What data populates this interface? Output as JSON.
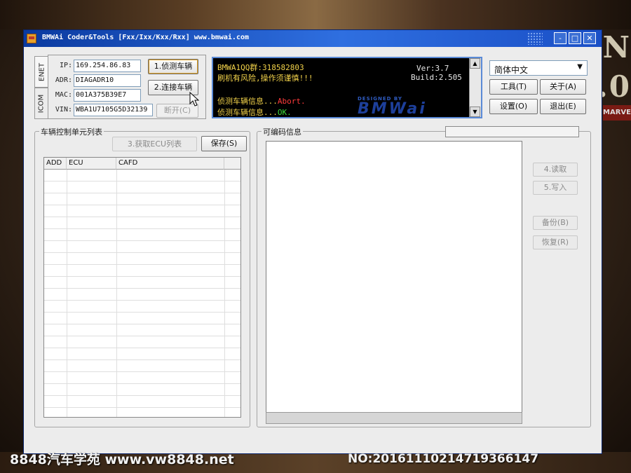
{
  "window": {
    "title": "BMWAi Coder&Tools [Fxx/Ixx/Kxx/Rxx]  www.bmwai.com",
    "controls": {
      "minimize": "-",
      "maximize": "□",
      "close": "✕"
    }
  },
  "side_tabs": [
    "ENET",
    "ICOM"
  ],
  "connection": {
    "ip_label": "IP:",
    "ip_value": "169.254.86.83",
    "adr_label": "ADR:",
    "adr_value": "DIAGADR10",
    "mac_label": "MAC:",
    "mac_value": "001A375B39E7",
    "vin_label": "VIN:",
    "vin_value": "WBA1U7105G5D32139",
    "detect_button": "1.侦测车辆",
    "connect_button": "2.连接车辆",
    "disconnect_button": "断开(C)"
  },
  "console": {
    "line1": "BMWA1QQ群:318582803",
    "line2": "刷机有风险,操作须谨慎!!!",
    "version": "Ver:3.7",
    "build": "Build:2.505",
    "log1_prefix": "侦测车辆信息...",
    "log1_status": "Abort.",
    "log2_prefix": "侦测车辆信息...",
    "log2_status": "OK.",
    "logo_small": "DESIGNED BY",
    "logo_big": "BMWai"
  },
  "language_select": {
    "value": "简体中文",
    "arrow": "▼"
  },
  "menu_buttons": {
    "tools": "工具(T)",
    "about": "关于(A)",
    "settings": "设置(O)",
    "exit": "退出(E)"
  },
  "ecu_panel": {
    "title": "车辆控制单元列表",
    "get_ecu_button": "3.获取ECU列表",
    "save_button": "保存(S)",
    "columns": [
      "ADD",
      "ECU",
      "CAFD"
    ]
  },
  "coding_panel": {
    "title": "可编码信息",
    "read_button": "4.读取",
    "write_button": "5.写入",
    "backup_button": "备份(B)",
    "restore_button": "恢复(R)"
  },
  "background": {
    "letters": "N\n.0",
    "badge": "MARVEL"
  },
  "captions": {
    "left": "8848汽车学苑 www.vw8848.net",
    "right": "NO:20161110214719366147"
  },
  "colors": {
    "console_text": "#f2d24a",
    "abort": "#ff3b3b",
    "ok": "#3bdc3b",
    "titlebar": "#2f6fe0"
  }
}
